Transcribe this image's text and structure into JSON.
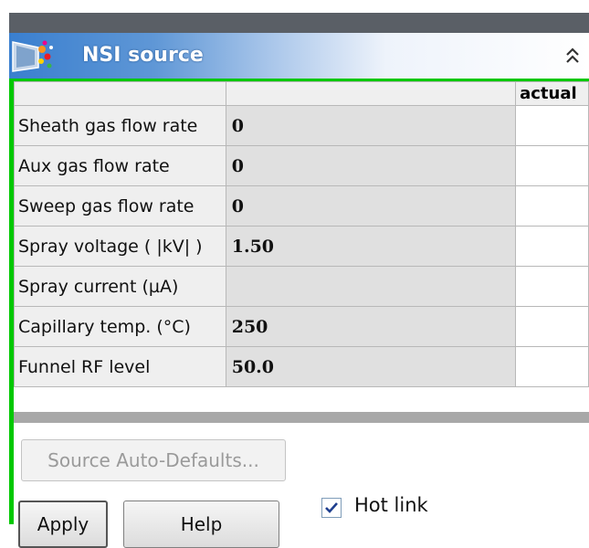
{
  "window": {
    "title": "NSI source"
  },
  "table": {
    "header": {
      "actual_label": "actual"
    },
    "rows": [
      {
        "label": "Sheath gas flow rate",
        "value": "0"
      },
      {
        "label": "Aux gas flow rate",
        "value": "0"
      },
      {
        "label": "Sweep gas flow rate",
        "value": "0"
      },
      {
        "label": "Spray voltage ( |kV| )",
        "value": "1.50"
      },
      {
        "label": "Spray current (µA)",
        "value": ""
      },
      {
        "label": "Capillary temp. (°C)",
        "value": "250"
      },
      {
        "label": "Funnel RF level",
        "value": "50.0"
      }
    ]
  },
  "buttons": {
    "auto_defaults": "Source Auto-Defaults...",
    "apply": "Apply",
    "help": "Help"
  },
  "hot_link": {
    "label": "Hot link",
    "checked": true
  },
  "colors": {
    "accent_green": "#00c800",
    "title_blue": "#3a7fcf"
  },
  "icons": {
    "app": "nsi-source-app-icon",
    "collapse": "double-chevron-up-icon",
    "check": "checkmark-icon"
  }
}
